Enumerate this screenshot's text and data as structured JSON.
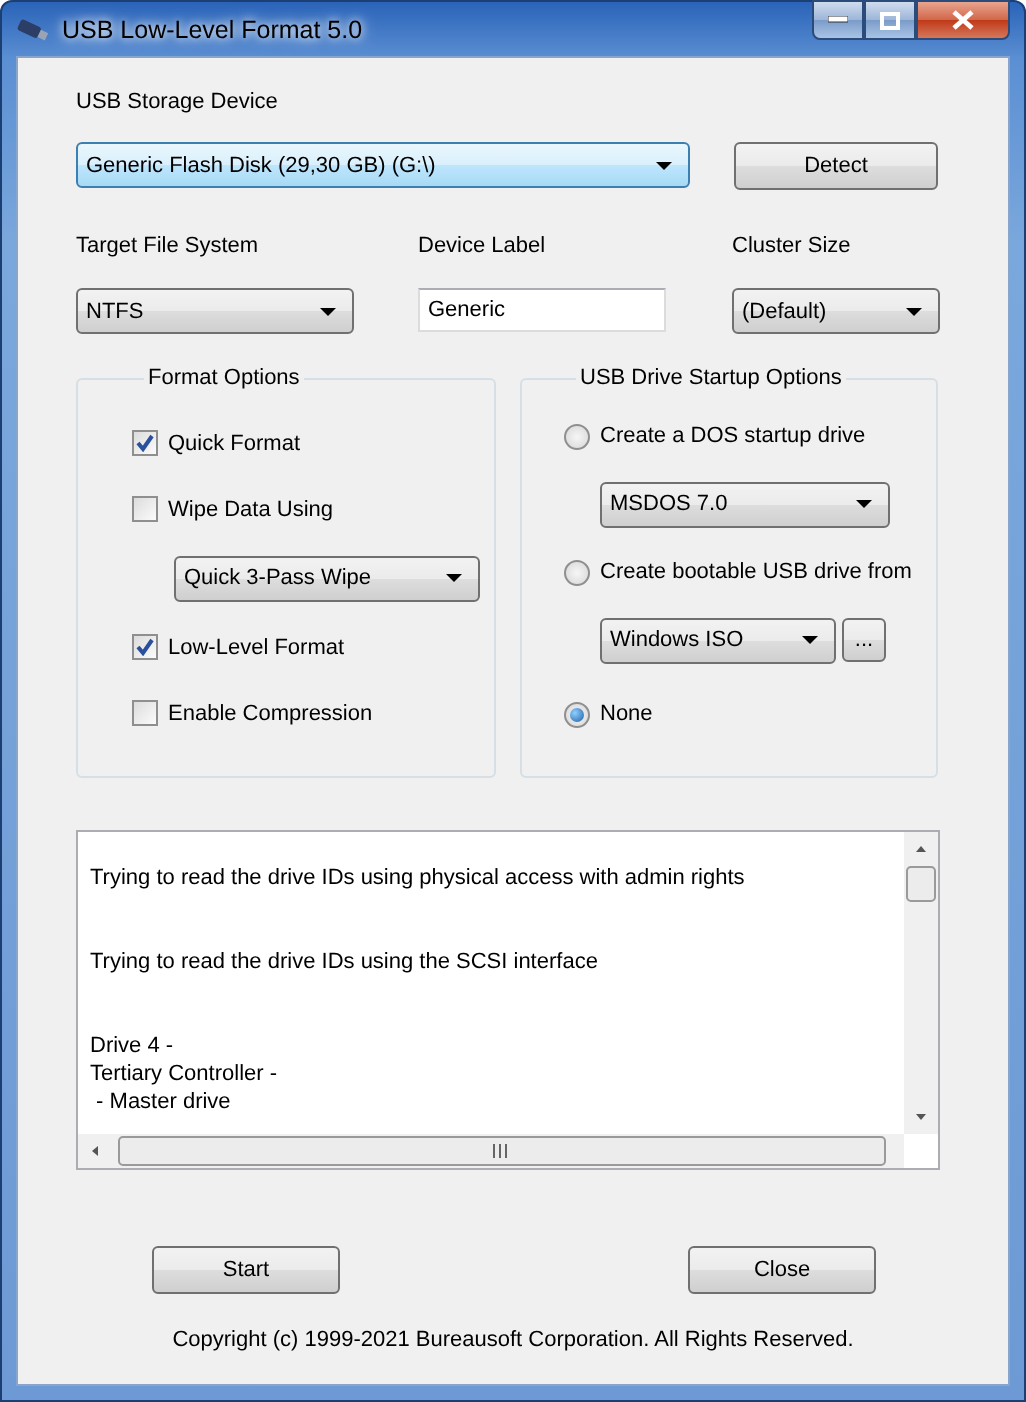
{
  "window": {
    "title": "USB Low-Level Format 5.0"
  },
  "device": {
    "label": "USB Storage Device",
    "value": "Generic Flash Disk (29,30 GB) (G:\\)",
    "focused": true
  },
  "detect_button": "Detect",
  "file_system": {
    "label": "Target File System",
    "value": "NTFS"
  },
  "device_label": {
    "label": "Device Label",
    "value": "Generic"
  },
  "cluster_size": {
    "label": "Cluster Size",
    "value": "(Default)"
  },
  "format_options": {
    "title": "Format Options",
    "items": [
      {
        "kind": "checkbox",
        "label": "Quick Format",
        "checked": true
      },
      {
        "kind": "checkbox",
        "label": "Wipe Data Using",
        "checked": false
      },
      {
        "kind": "dropdown",
        "value": "Quick 3-Pass Wipe"
      },
      {
        "kind": "checkbox",
        "label": "Low-Level Format",
        "checked": true
      },
      {
        "kind": "checkbox",
        "label": "Enable Compression",
        "checked": false
      }
    ]
  },
  "startup_options": {
    "title": "USB Drive Startup Options",
    "items": [
      {
        "kind": "radio",
        "label": "Create a DOS startup drive",
        "selected": false
      },
      {
        "kind": "dropdown",
        "value": "MSDOS 7.0"
      },
      {
        "kind": "radio",
        "label": "Create bootable USB drive from",
        "selected": false
      },
      {
        "kind": "dropdown_browse",
        "value": "Windows ISO",
        "browse": "..."
      },
      {
        "kind": "radio",
        "label": "None",
        "selected": true
      }
    ]
  },
  "log": {
    "paragraphs": [
      [
        "Trying to read the drive IDs using physical access with admin rights"
      ],
      [
        "Trying to read the drive IDs using the SCSI interface"
      ],
      [
        "Drive 4 -",
        "Tertiary Controller -",
        " - Master drive"
      ]
    ]
  },
  "buttons": [
    "Start",
    "Close"
  ],
  "copyright": "Copyright (c) 1999-2021 Bureausoft Corporation. All Rights Reserved."
}
